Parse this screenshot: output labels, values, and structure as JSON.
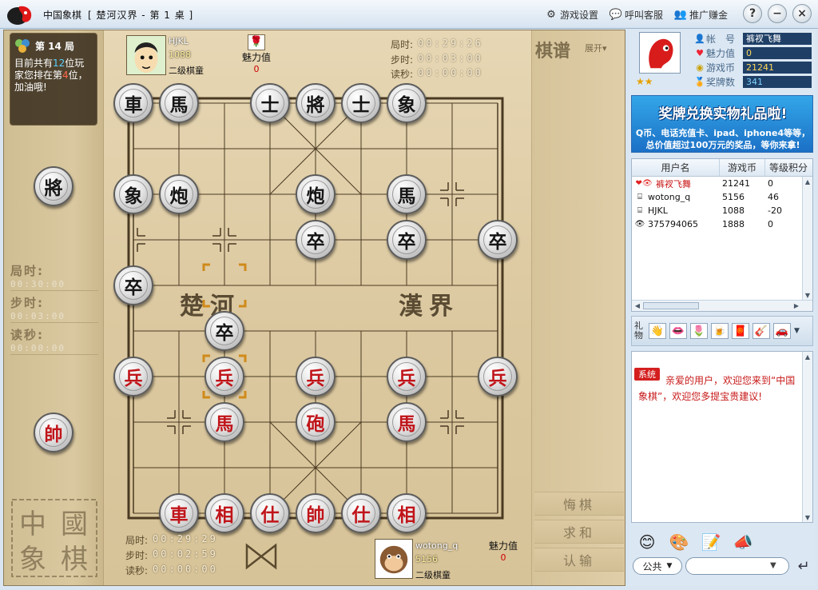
{
  "window": {
    "app_title": "中国象棋",
    "table_title": "[ 楚河汉界 - 第 1 桌 ]",
    "links": {
      "settings": "游戏设置",
      "service": "呼叫客服",
      "promote": "推广赚金"
    },
    "buttons": {
      "help": "?",
      "minimize": "−",
      "close": "×"
    }
  },
  "left_panel": {
    "round": "第 14 局",
    "rank_prefix": "目前共有",
    "player_count": "12",
    "rank_mid": "位玩家您排在第",
    "rank": "4",
    "rank_suffix": "位，加油哦!",
    "timers": [
      {
        "label": "局时:",
        "value": "00:30:00"
      },
      {
        "label": "步时:",
        "value": "00:03:00"
      },
      {
        "label": "读秒:",
        "value": "00:00:00"
      }
    ],
    "side_pieces": [
      {
        "char": "將",
        "side": "black"
      },
      {
        "char": "帥",
        "side": "red"
      }
    ],
    "seal_text": [
      "中",
      "國",
      "象",
      "棋"
    ]
  },
  "board": {
    "river_left": "楚河",
    "river_right": "漢界",
    "pieces": [
      {
        "char": "車",
        "side": "black",
        "col": 0,
        "row": 0
      },
      {
        "char": "馬",
        "side": "black",
        "col": 1,
        "row": 0
      },
      {
        "char": "士",
        "side": "black",
        "col": 3,
        "row": 0
      },
      {
        "char": "將",
        "side": "black",
        "col": 4,
        "row": 0
      },
      {
        "char": "士",
        "side": "black",
        "col": 5,
        "row": 0
      },
      {
        "char": "象",
        "side": "black",
        "col": 6,
        "row": 0
      },
      {
        "char": "象",
        "side": "black",
        "col": 0,
        "row": 2
      },
      {
        "char": "炮",
        "side": "black",
        "col": 1,
        "row": 2
      },
      {
        "char": "炮",
        "side": "black",
        "col": 4,
        "row": 2
      },
      {
        "char": "馬",
        "side": "black",
        "col": 6,
        "row": 2
      },
      {
        "char": "卒",
        "side": "black",
        "col": 4,
        "row": 3
      },
      {
        "char": "卒",
        "side": "black",
        "col": 6,
        "row": 3
      },
      {
        "char": "卒",
        "side": "black",
        "col": 8,
        "row": 3
      },
      {
        "char": "卒",
        "side": "black",
        "col": 0,
        "row": 4
      },
      {
        "char": "卒",
        "side": "black",
        "col": 2,
        "row": 5
      },
      {
        "char": "兵",
        "side": "red",
        "col": 0,
        "row": 6
      },
      {
        "char": "兵",
        "side": "red",
        "col": 2,
        "row": 6
      },
      {
        "char": "兵",
        "side": "red",
        "col": 4,
        "row": 6
      },
      {
        "char": "兵",
        "side": "red",
        "col": 6,
        "row": 6
      },
      {
        "char": "兵",
        "side": "red",
        "col": 8,
        "row": 6
      },
      {
        "char": "馬",
        "side": "red",
        "col": 2,
        "row": 7
      },
      {
        "char": "砲",
        "side": "red",
        "col": 4,
        "row": 7
      },
      {
        "char": "馬",
        "side": "red",
        "col": 6,
        "row": 7
      },
      {
        "char": "車",
        "side": "red",
        "col": 1,
        "row": 9
      },
      {
        "char": "相",
        "side": "red",
        "col": 2,
        "row": 9
      },
      {
        "char": "仕",
        "side": "red",
        "col": 3,
        "row": 9
      },
      {
        "char": "帥",
        "side": "red",
        "col": 4,
        "row": 9
      },
      {
        "char": "仕",
        "side": "red",
        "col": 5,
        "row": 9
      },
      {
        "char": "相",
        "side": "red",
        "col": 6,
        "row": 9
      }
    ]
  },
  "top_player": {
    "name": "HJKL",
    "score": "1088",
    "level": "二级棋童",
    "charm_label": "魅力值",
    "charm": "0",
    "timers": [
      {
        "label": "局时:",
        "value": "00:29:26"
      },
      {
        "label": "步时:",
        "value": "00:03:00"
      },
      {
        "label": "读秒:",
        "value": "00:00:00"
      }
    ]
  },
  "bottom_player": {
    "name": "wotong_q",
    "score": "5156",
    "level": "二级棋童",
    "charm_label": "魅力值",
    "charm": "0",
    "timers": [
      {
        "label": "局时:",
        "value": "00:29:29"
      },
      {
        "label": "步时:",
        "value": "00:02:59"
      },
      {
        "label": "读秒:",
        "value": "00:00:00"
      }
    ]
  },
  "game_side": {
    "qipu_title": "棋谱",
    "expand": "展开▾",
    "buttons": [
      "悔棋",
      "求和",
      "认输"
    ]
  },
  "profile": {
    "account_label": "帐　号",
    "account": "裤衩飞舞",
    "charm_label": "魅力值",
    "charm": "0",
    "coins_label": "游戏币",
    "coins": "21241",
    "medals_label": "奖牌数",
    "medals": "341",
    "stars": "★★"
  },
  "banner": {
    "title": "奖牌兑换实物礼品啦!",
    "line1": "Q币、电话充值卡、ipad、iphone4等等，",
    "line2": "总价值超过100万元的奖品，等你来拿!"
  },
  "user_table": {
    "headers": [
      "用户名",
      "游戏币",
      "等级积分"
    ],
    "rows": [
      {
        "icon": "heart-eye-icon",
        "name": "裤衩飞舞",
        "coins": "21241",
        "score": "0",
        "self": true
      },
      {
        "icon": "seat-icon",
        "name": "wotong_q",
        "coins": "5156",
        "score": "46",
        "self": false
      },
      {
        "icon": "seat-icon",
        "name": "HJKL",
        "coins": "1088",
        "score": "-20",
        "self": false
      },
      {
        "icon": "eye-icon",
        "name": "375794065",
        "coins": "1888",
        "score": "0",
        "self": false
      }
    ]
  },
  "gifts": {
    "label": "礼物",
    "items": [
      "👋",
      "👄",
      "🌷",
      "🍺",
      "🧧",
      "🎸",
      "🚗"
    ]
  },
  "chat": {
    "system_tag": "系统",
    "message": "亲爱的用户，欢迎您来到“中国象棋”，欢迎您多提宝贵建议!",
    "channel": "公共",
    "input_value": ""
  },
  "colors": {
    "red_piece": "#c0151a",
    "black_piece": "#151515",
    "board_wood": "#dcc9a1",
    "sidebar_bg": "#dbe7f3"
  }
}
